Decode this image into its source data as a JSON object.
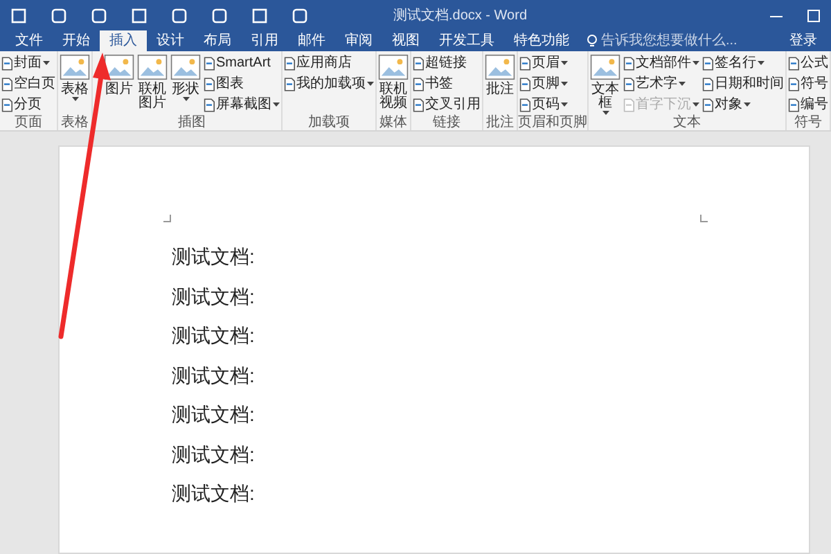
{
  "window": {
    "title": "测试文档.docx - Word"
  },
  "tabs": [
    {
      "label": "文件",
      "selected": false
    },
    {
      "label": "开始",
      "selected": false
    },
    {
      "label": "插入",
      "selected": true
    },
    {
      "label": "设计",
      "selected": false
    },
    {
      "label": "布局",
      "selected": false
    },
    {
      "label": "引用",
      "selected": false
    },
    {
      "label": "邮件",
      "selected": false
    },
    {
      "label": "审阅",
      "selected": false
    },
    {
      "label": "视图",
      "selected": false
    },
    {
      "label": "开发工具",
      "selected": false
    },
    {
      "label": "特色功能",
      "selected": false
    }
  ],
  "tell_me": {
    "placeholder": "告诉我您想要做什么..."
  },
  "sign_in": "登录",
  "ribbon": [
    {
      "label": "页面",
      "columns": [
        [
          {
            "label": "封面",
            "kind": "small",
            "dropdown": true,
            "disabled": false
          },
          {
            "label": "空白页",
            "kind": "small",
            "dropdown": false,
            "disabled": false
          },
          {
            "label": "分页",
            "kind": "small",
            "dropdown": false,
            "disabled": false
          }
        ]
      ]
    },
    {
      "label": "表格",
      "columns": [
        [
          {
            "label": "表格",
            "kind": "large",
            "dropdown": true,
            "disabled": false
          }
        ]
      ]
    },
    {
      "label": "插图",
      "columns": [
        [
          {
            "label": "图片",
            "kind": "large",
            "dropdown": false,
            "disabled": false
          }
        ],
        [
          {
            "label": "联机图片",
            "kind": "large",
            "dropdown": false,
            "disabled": false
          }
        ],
        [
          {
            "label": "形状",
            "kind": "large",
            "dropdown": true,
            "disabled": false
          }
        ],
        [
          {
            "label": "SmartArt",
            "kind": "small",
            "dropdown": false,
            "disabled": false
          },
          {
            "label": "图表",
            "kind": "small",
            "dropdown": false,
            "disabled": false
          },
          {
            "label": "屏幕截图",
            "kind": "small",
            "dropdown": true,
            "disabled": false
          }
        ]
      ]
    },
    {
      "label": "加载项",
      "columns": [
        [
          {
            "label": "应用商店",
            "kind": "small",
            "dropdown": false,
            "disabled": false
          },
          {
            "label": "我的加载项",
            "kind": "small",
            "dropdown": true,
            "disabled": false
          }
        ]
      ]
    },
    {
      "label": "媒体",
      "columns": [
        [
          {
            "label": "联机视频",
            "kind": "large",
            "dropdown": false,
            "disabled": false
          }
        ]
      ]
    },
    {
      "label": "链接",
      "columns": [
        [
          {
            "label": "超链接",
            "kind": "small",
            "dropdown": false,
            "disabled": false
          },
          {
            "label": "书签",
            "kind": "small",
            "dropdown": false,
            "disabled": false
          },
          {
            "label": "交叉引用",
            "kind": "small",
            "dropdown": false,
            "disabled": false
          }
        ]
      ]
    },
    {
      "label": "批注",
      "columns": [
        [
          {
            "label": "批注",
            "kind": "large",
            "dropdown": false,
            "disabled": false
          }
        ]
      ]
    },
    {
      "label": "页眉和页脚",
      "columns": [
        [
          {
            "label": "页眉",
            "kind": "small",
            "dropdown": true,
            "disabled": false
          },
          {
            "label": "页脚",
            "kind": "small",
            "dropdown": true,
            "disabled": false
          },
          {
            "label": "页码",
            "kind": "small",
            "dropdown": true,
            "disabled": false
          }
        ]
      ]
    },
    {
      "label": "文本",
      "columns": [
        [
          {
            "label": "文本框",
            "kind": "large",
            "dropdown": true,
            "disabled": false
          }
        ],
        [
          {
            "label": "文档部件",
            "kind": "small",
            "dropdown": true,
            "disabled": false
          },
          {
            "label": "艺术字",
            "kind": "small",
            "dropdown": true,
            "disabled": false
          },
          {
            "label": "首字下沉",
            "kind": "small",
            "dropdown": true,
            "disabled": true
          }
        ],
        [
          {
            "label": "签名行",
            "kind": "small",
            "dropdown": true,
            "disabled": false
          },
          {
            "label": "日期和时间",
            "kind": "small",
            "dropdown": false,
            "disabled": false
          },
          {
            "label": "对象",
            "kind": "small",
            "dropdown": true,
            "disabled": false
          }
        ]
      ]
    },
    {
      "label": "符号",
      "columns": [
        [
          {
            "label": "公式",
            "kind": "small",
            "dropdown": false,
            "disabled": false
          },
          {
            "label": "符号",
            "kind": "small",
            "dropdown": false,
            "disabled": false
          },
          {
            "label": "编号",
            "kind": "small",
            "dropdown": false,
            "disabled": false
          }
        ]
      ]
    }
  ],
  "document": {
    "lines": [
      "测试文档:",
      "测试文档:",
      "测试文档:",
      "测试文档:",
      "测试文档:",
      "测试文档:",
      "测试文档:"
    ]
  }
}
